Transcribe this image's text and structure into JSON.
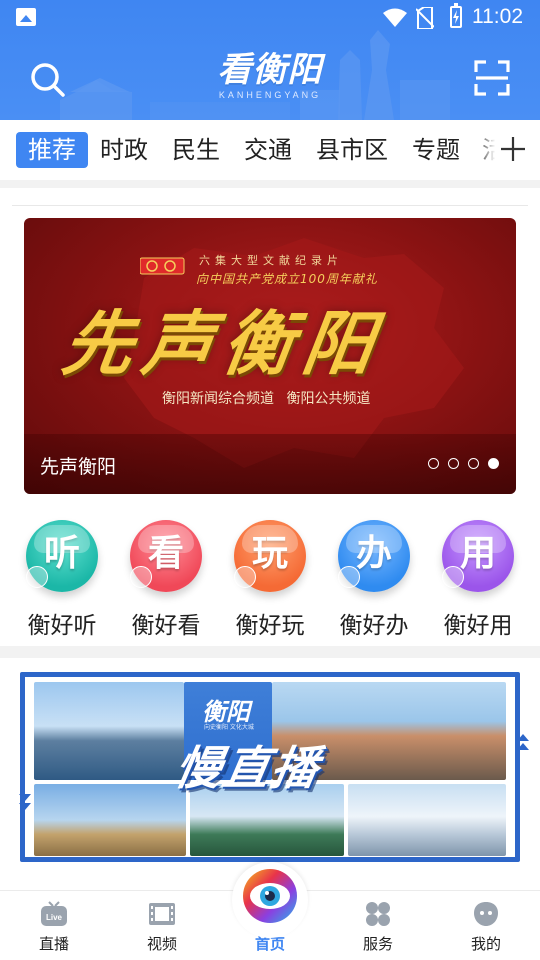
{
  "status_bar": {
    "time": "11:02",
    "icons": [
      "gallery-icon",
      "wifi-icon",
      "no-sim-icon",
      "battery-charging-icon"
    ]
  },
  "header": {
    "logo_main": "看衡阳",
    "logo_sub": "KANHENGYANG",
    "left_icon": "search-icon",
    "right_icon": "scan-icon",
    "bg_color": "#3f86f2"
  },
  "tabs": {
    "items": [
      {
        "label": "推荐",
        "active": true
      },
      {
        "label": "时政",
        "active": false
      },
      {
        "label": "民生",
        "active": false
      },
      {
        "label": "交通",
        "active": false
      },
      {
        "label": "县市区",
        "active": false
      },
      {
        "label": "专题",
        "active": false
      },
      {
        "label": "活",
        "active": false
      }
    ],
    "add_icon": "plus-icon",
    "active_color": "#3f86f2"
  },
  "banner": {
    "subtitle": "六集大型文献纪录片",
    "line2": "向中国共产党成立100周年献礼",
    "calligraphy": "先声衡阳",
    "channels": "衡阳新闻综合频道 衡阳公共频道",
    "caption": "先声衡阳",
    "dots_count": 4,
    "active_dot": 4
  },
  "features": [
    {
      "char": "听",
      "label": "衡好听",
      "color": "#1bb7a7",
      "mini_icon": "headphones-icon"
    },
    {
      "char": "看",
      "label": "衡好看",
      "color": "#f04858",
      "mini_icon": "eye-icon"
    },
    {
      "char": "玩",
      "label": "衡好玩",
      "color": "#f56a35",
      "mini_icon": "plane-icon"
    },
    {
      "char": "办",
      "label": "衡好办",
      "color": "#2f8bf0",
      "mini_icon": "runner-icon"
    },
    {
      "char": "用",
      "label": "衡好用",
      "color": "#9b55ea",
      "mini_icon": "bulb-icon"
    }
  ],
  "live_card": {
    "title": "慢直播",
    "brand": "衡阳",
    "brand_small": "向史衡阳 文化大城"
  },
  "bottom_nav": {
    "items": [
      {
        "label": "直播",
        "icon": "tv-live-icon",
        "active": false
      },
      {
        "label": "视频",
        "icon": "film-icon",
        "active": false
      },
      {
        "label": "首页",
        "icon": "eye-logo-icon",
        "active": true
      },
      {
        "label": "服务",
        "icon": "grid-icon",
        "active": false
      },
      {
        "label": "我的",
        "icon": "profile-icon",
        "active": false
      }
    ],
    "active_color": "#3f86f2"
  }
}
